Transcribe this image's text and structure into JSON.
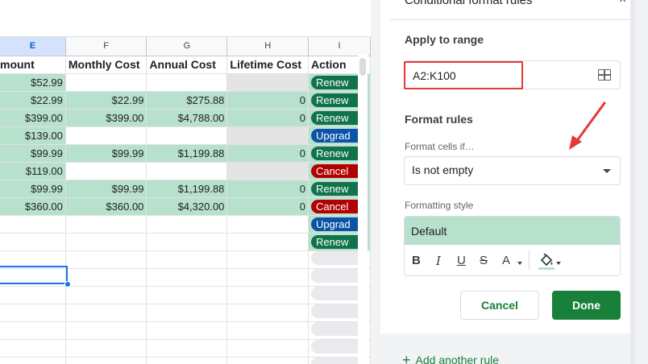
{
  "sheet": {
    "col_letters": [
      "E",
      "F",
      "G",
      "H",
      "I"
    ],
    "headers": [
      "mount",
      "Monthly Cost",
      "Annual Cost",
      "Lifetime Cost",
      "Action"
    ],
    "rows": [
      {
        "e": "$52.99",
        "f": "",
        "g": "",
        "h": "",
        "action": "Renew"
      },
      {
        "e": "$22.99",
        "f": "$22.99",
        "g": "$275.88",
        "h": "0",
        "action": "Renew"
      },
      {
        "e": "$399.00",
        "f": "$399.00",
        "g": "$4,788.00",
        "h": "0",
        "action": "Renew"
      },
      {
        "e": "$139.00",
        "f": "",
        "g": "",
        "h": "",
        "action": "Upgrad"
      },
      {
        "e": "$99.99",
        "f": "$99.99",
        "g": "$1,199.88",
        "h": "0",
        "action": "Renew"
      },
      {
        "e": "$119.00",
        "f": "",
        "g": "",
        "h": "",
        "action": "Cancel"
      },
      {
        "e": "$99.99",
        "f": "$99.99",
        "g": "$1,199.88",
        "h": "0",
        "action": "Renew"
      },
      {
        "e": "$360.00",
        "f": "$360.00",
        "g": "$4,320.00",
        "h": "0",
        "action": "Cancel"
      },
      {
        "e": "",
        "f": "",
        "g": "",
        "h": "",
        "action": "Upgrad"
      },
      {
        "e": "",
        "f": "",
        "g": "",
        "h": "",
        "action": "Renew"
      }
    ]
  },
  "panel": {
    "title": "Conditional format rules",
    "close": "×",
    "apply_label": "Apply to range",
    "range_value": "A2:K100",
    "format_rules_label": "Format rules",
    "format_cells_if_label": "Format cells if…",
    "condition_value": "Is not empty",
    "formatting_style_label": "Formatting style",
    "style_default": "Default",
    "toolbar": {
      "bold": "B",
      "italic": "I",
      "underline": "U",
      "strike": "S",
      "text_color": "A"
    },
    "cancel_label": "Cancel",
    "done_label": "Done",
    "add_rule_label": "Add another rule",
    "add_rule_plus": "+"
  },
  "colors": {
    "highlight_green": "#b7e1cd",
    "accent_green": "#188038",
    "annotation_red": "#e53935",
    "selection_blue": "#1a73e8"
  }
}
